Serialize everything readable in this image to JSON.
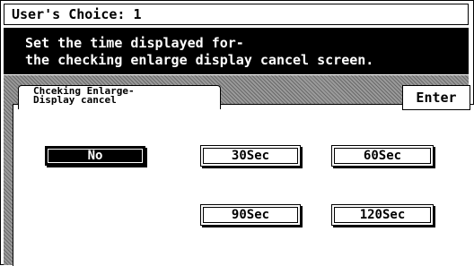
{
  "header": {
    "title": "User's Choice: 1"
  },
  "message": {
    "line1": "Set the time displayed for-",
    "line2": "the checking enlarge display cancel screen."
  },
  "panel": {
    "tab_label": "Chceking Enlarge-\nDisplay cancel",
    "enter_label": "Enter"
  },
  "options": {
    "no": "No",
    "sec30": "30Sec",
    "sec60": "60Sec",
    "sec90": "90Sec",
    "sec120": "120Sec",
    "selected": "No"
  },
  "colors": {
    "background": "#ffffff",
    "banner": "#000000",
    "hatch": "#9a9a9a"
  }
}
